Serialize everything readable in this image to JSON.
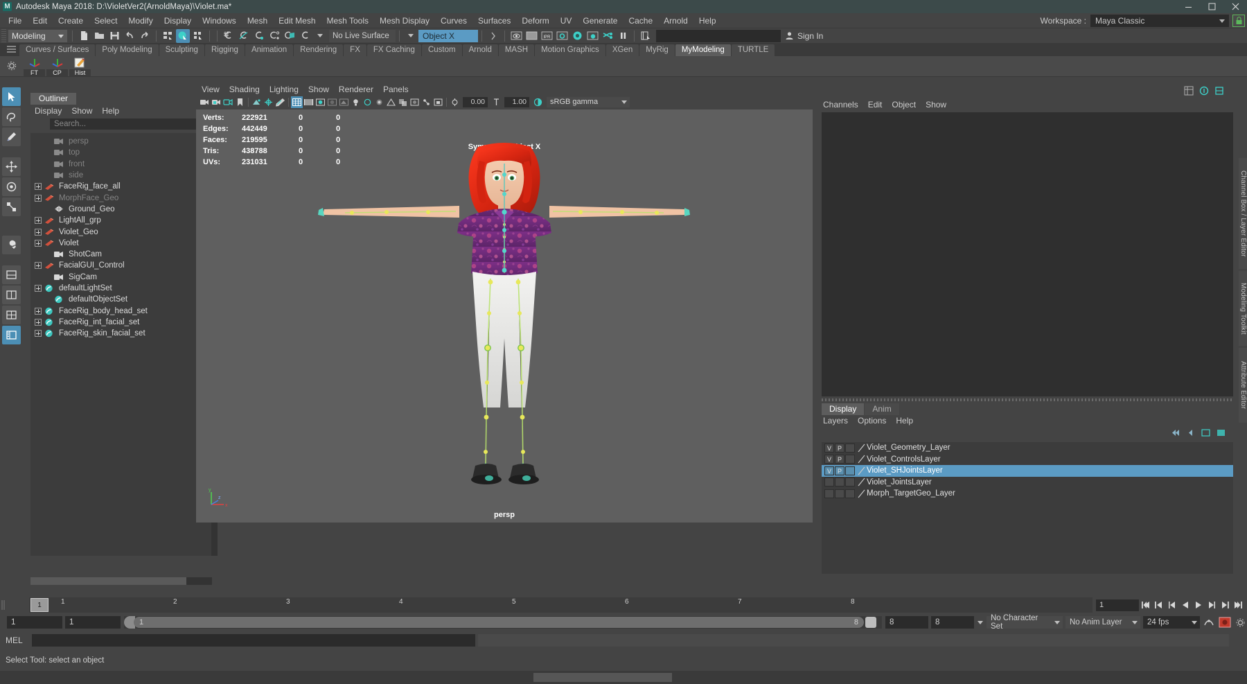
{
  "window": {
    "title": "Autodesk Maya 2018: D:\\VioletVer2(ArnoldMaya)\\Violet.ma*",
    "logo": "M",
    "minimize": "minimize-icon",
    "maximize": "maximize-icon",
    "close": "close-icon"
  },
  "menubar": {
    "items": [
      "File",
      "Edit",
      "Create",
      "Select",
      "Modify",
      "Display",
      "Windows",
      "Mesh",
      "Edit Mesh",
      "Mesh Tools",
      "Mesh Display",
      "Curves",
      "Surfaces",
      "Deform",
      "UV",
      "Generate",
      "Cache",
      "Arnold",
      "Help"
    ],
    "workspace_label": "Workspace :",
    "workspace_value": "Maya Classic",
    "lock_icon": "lock-icon",
    "lock_color": "#5cb85c"
  },
  "statusline": {
    "mode": "Modeling",
    "live_surface": "No Live Surface",
    "object_field": "Object X",
    "object_field_color": "#5b9bc4",
    "signin": "Sign In",
    "icons": [
      "new-scene-icon",
      "open-scene-icon",
      "save-scene-icon",
      "undo-icon",
      "redo-icon",
      "select-hierarchy-icon",
      "select-object-icon",
      "select-component-icon",
      "snap-grid-icon",
      "snap-curve-icon",
      "snap-point-icon",
      "snap-projected-icon",
      "snap-view-plane-icon",
      "make-live-icon",
      "render-view-icon",
      "render-sequence-icon",
      "ipr-render-icon",
      "render-settings-icon",
      "hypershade-icon",
      "render-setup-icon",
      "toggle-render-icon",
      "pause-icon",
      "attribute-editor-icon"
    ]
  },
  "shelf": {
    "tabs": [
      "Curves / Surfaces",
      "Poly Modeling",
      "Sculpting",
      "Rigging",
      "Animation",
      "Rendering",
      "FX",
      "FX Caching",
      "Custom",
      "Arnold",
      "MASH",
      "Motion Graphics",
      "XGen",
      "MyRig",
      "MyModeling",
      "TURTLE"
    ],
    "active_tab": "MyModeling",
    "buttons": [
      {
        "label": "FT",
        "icon": "axis-gizmo-icon"
      },
      {
        "label": "CP",
        "icon": "axis-gizmo-icon"
      },
      {
        "label": "Hist",
        "icon": "pencil-note-icon"
      }
    ],
    "gear_icon": "gear-icon"
  },
  "toolbox": {
    "items": [
      {
        "name": "select-tool",
        "icon": "arrow-cursor-icon",
        "selected": true
      },
      {
        "name": "lasso-tool",
        "icon": "lasso-icon",
        "selected": false
      },
      {
        "name": "paint-select-tool",
        "icon": "paintbrush-icon",
        "selected": false
      },
      {
        "name": "move-tool",
        "icon": "move-arrows-icon",
        "selected": false
      },
      {
        "name": "rotate-tool",
        "icon": "rotate-circle-icon",
        "selected": false
      },
      {
        "name": "scale-tool",
        "icon": "scale-box-icon",
        "selected": false
      },
      {
        "name": "last-tool",
        "icon": "wrench-icon",
        "selected": false
      },
      {
        "name": "layout-single",
        "icon": "layout-single-icon",
        "selected": false
      },
      {
        "name": "layout-two-pane",
        "icon": "layout-two-pane-icon",
        "selected": false
      },
      {
        "name": "layout-four-pane",
        "icon": "layout-four-pane-icon",
        "selected": false
      },
      {
        "name": "layout-outliner-persp",
        "icon": "layout-outliner-icon",
        "selected": true
      }
    ]
  },
  "outliner": {
    "tab": "Outliner",
    "menus": [
      "Display",
      "Show",
      "Help"
    ],
    "search_placeholder": "Search...",
    "search_icon": "search-frame-icon",
    "items": [
      {
        "label": "persp",
        "icon": "camera-icon",
        "expand": false,
        "dim": true,
        "indent": 1
      },
      {
        "label": "top",
        "icon": "camera-icon",
        "expand": false,
        "dim": true,
        "indent": 1
      },
      {
        "label": "front",
        "icon": "camera-icon",
        "expand": false,
        "dim": true,
        "indent": 1
      },
      {
        "label": "side",
        "icon": "camera-icon",
        "expand": false,
        "dim": true,
        "indent": 1
      },
      {
        "label": "FaceRig_face_all",
        "icon": "transform-icon",
        "expand": true,
        "dim": false,
        "indent": 0
      },
      {
        "label": "MorphFace_Geo",
        "icon": "transform-icon",
        "expand": true,
        "dim": true,
        "indent": 0
      },
      {
        "label": "Ground_Geo",
        "icon": "mesh-icon",
        "expand": false,
        "dim": false,
        "indent": 1
      },
      {
        "label": "LightAll_grp",
        "icon": "transform-icon",
        "expand": true,
        "dim": false,
        "indent": 0
      },
      {
        "label": "Violet_Geo",
        "icon": "transform-icon",
        "expand": true,
        "dim": false,
        "indent": 0
      },
      {
        "label": "Violet",
        "icon": "transform-icon",
        "expand": true,
        "dim": false,
        "indent": 0
      },
      {
        "label": "ShotCam",
        "icon": "camera-icon",
        "expand": false,
        "dim": false,
        "indent": 1
      },
      {
        "label": "FacialGUI_Control",
        "icon": "transform-icon",
        "expand": true,
        "dim": false,
        "indent": 0
      },
      {
        "label": "SigCam",
        "icon": "camera-icon",
        "expand": false,
        "dim": false,
        "indent": 1
      },
      {
        "label": "defaultLightSet",
        "icon": "set-icon",
        "expand": true,
        "dim": false,
        "indent": 0
      },
      {
        "label": "defaultObjectSet",
        "icon": "set-icon",
        "expand": false,
        "dim": false,
        "indent": 1
      },
      {
        "label": "FaceRig_body_head_set",
        "icon": "set-icon",
        "expand": true,
        "dim": false,
        "indent": 0
      },
      {
        "label": "FaceRig_int_facial_set",
        "icon": "set-icon",
        "expand": true,
        "dim": false,
        "indent": 0
      },
      {
        "label": "FaceRig_skin_facial_set",
        "icon": "set-icon",
        "expand": true,
        "dim": false,
        "indent": 0
      }
    ]
  },
  "viewport": {
    "menus": [
      "View",
      "Shading",
      "Lighting",
      "Show",
      "Renderer",
      "Panels"
    ],
    "exposure": "0.00",
    "gamma_value": "1.00",
    "color_space": "sRGB gamma",
    "panel_name": "persp",
    "symmetry": "Symmetry: Object X",
    "hud": {
      "rows": [
        {
          "label": "Verts:",
          "total": "222921",
          "col2": "0",
          "col3": "0"
        },
        {
          "label": "Edges:",
          "total": "442449",
          "col2": "0",
          "col3": "0"
        },
        {
          "label": "Faces:",
          "total": "219595",
          "col2": "0",
          "col3": "0"
        },
        {
          "label": "Tris:",
          "total": "438788",
          "col2": "0",
          "col3": "0"
        },
        {
          "label": "UVs:",
          "total": "231031",
          "col2": "0",
          "col3": "0"
        }
      ]
    },
    "axis_gizmo": "axis-gizmo-icon"
  },
  "channelbox": {
    "menus": [
      "Channels",
      "Edit",
      "Object",
      "Show"
    ],
    "icons": [
      "channel-box-icon",
      "attribute-editor-icon",
      "modeling-toolkit-icon"
    ]
  },
  "layereditor": {
    "tabs": [
      "Display",
      "Anim"
    ],
    "active_tab": "Display",
    "menus": [
      "Layers",
      "Options",
      "Help"
    ],
    "toolbar_icons": [
      "layer-first-icon",
      "layer-prev-icon",
      "layer-next-icon",
      "layer-last-icon"
    ],
    "selected_color": "#5b9bc4",
    "layers": [
      {
        "v": "V",
        "p": "P",
        "r": "",
        "name": "Violet_Geometry_Layer",
        "selected": false,
        "swatch": "#6f6f6f"
      },
      {
        "v": "V",
        "p": "P",
        "r": "",
        "name": "Violet_ControlsLayer",
        "selected": false,
        "swatch": "#6f6f6f"
      },
      {
        "v": "V",
        "p": "P",
        "r": "",
        "name": "Violet_SHJointsLayer",
        "selected": true,
        "swatch": "#6f6f6f"
      },
      {
        "v": "",
        "p": "",
        "r": "",
        "name": "Violet_JointsLayer",
        "selected": false,
        "swatch": "#6f6f6f"
      },
      {
        "v": "",
        "p": "",
        "r": "",
        "name": "Morph_TargetGeo_Layer",
        "selected": false,
        "swatch": "#6f6f6f"
      }
    ]
  },
  "right_tabs": [
    "Channel Box / Layer Editor",
    "Modeling Toolkit",
    "Attribute Editor"
  ],
  "timeslider": {
    "current_frame": "1",
    "frame_field": "1",
    "ticks": [
      "1",
      "2",
      "3",
      "4",
      "5",
      "6",
      "7",
      "8"
    ],
    "playback_icons": [
      "go-to-start-icon",
      "step-back-key-icon",
      "step-back-frame-icon",
      "play-backwards-icon",
      "play-forwards-icon",
      "step-forward-frame-icon",
      "step-forward-key-icon",
      "go-to-end-icon"
    ]
  },
  "rangeslider": {
    "start": "1",
    "anim_start": "1",
    "range_start": "1",
    "range_end": "8",
    "anim_end": "8",
    "end": "8",
    "character_set": "No Character Set",
    "anim_layer": "No Anim Layer",
    "fps": "24 fps",
    "auto_key_icon": "auto-key-icon",
    "anim_pref_icon": "animation-preferences-icon"
  },
  "commandline": {
    "label": "MEL",
    "input_value": "",
    "output_value": ""
  },
  "helpline": {
    "text": "Select Tool: select an object"
  }
}
